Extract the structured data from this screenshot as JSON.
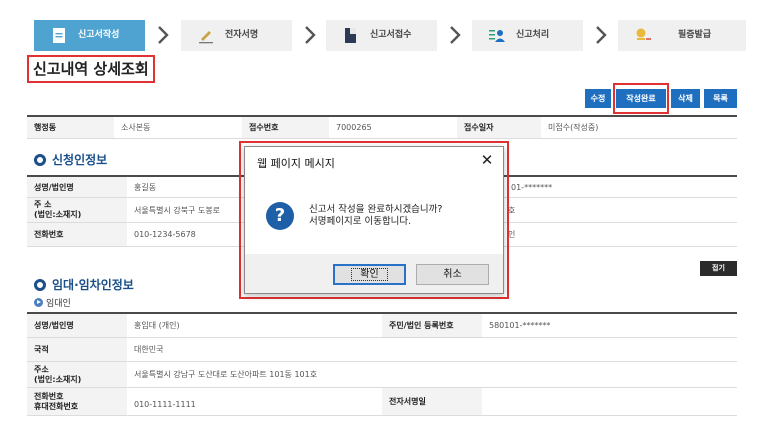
{
  "steps": [
    {
      "label": "신고서작성",
      "icon": "document-icon",
      "active": true
    },
    {
      "label": "전자서명",
      "icon": "pen-icon",
      "active": false
    },
    {
      "label": "신고서접수",
      "icon": "folder-icon",
      "active": false
    },
    {
      "label": "신고처리",
      "icon": "person-list-icon",
      "active": false
    },
    {
      "label": "필증발급",
      "icon": "certificate-icon",
      "active": false
    }
  ],
  "page_title": "신고내역 상세조회",
  "actions": {
    "edit": "수정",
    "complete": "작성완료",
    "delete": "삭제",
    "list": "목록"
  },
  "info": {
    "dong_label": "행정동",
    "dong_value": "소사본동",
    "receipt_no_label": "접수번호",
    "receipt_no_value": "7000265",
    "receipt_date_label": "접수일자",
    "receipt_date_value": "미접수(작성중)"
  },
  "applicant": {
    "section_title": "신청인정보",
    "name_label": "성명/법인명",
    "name_value": "홍길동",
    "rrn_value": "01-*******",
    "address_label": "주    소\n(법인:소재지)",
    "address_value": "서울특별시 강북구 도봉로",
    "address_tail": "호",
    "phone_label": "전화번호",
    "phone_value": "010-1234-5678",
    "phone_tail": "인"
  },
  "lease": {
    "section_title": "임대·임차인정보",
    "fold_label": "접기",
    "sub_title": "임대인",
    "name_label": "성명/법인명",
    "name_value": "홍임대 (개인)",
    "rrn_label": "주민/법인 등록번호",
    "rrn_value": "580101-*******",
    "nation_label": "국적",
    "nation_value": "대한민국",
    "address_label": "주소\n(법인:소재지)",
    "address_value": "서울특별시 강남구 도산대로 도산아파트 101동 101호",
    "phone_label": "전화번호\n휴대전화번호",
    "phone_value": "010-1111-1111",
    "esign_label": "전자서명일",
    "esign_value": ""
  },
  "dialog": {
    "title": "웹 페이지 메시지",
    "message_line1": "신고서 작성을 완료하시겠습니까?",
    "message_line2": "서명페이지로 이동합니다.",
    "ok": "확인",
    "cancel": "취소"
  }
}
